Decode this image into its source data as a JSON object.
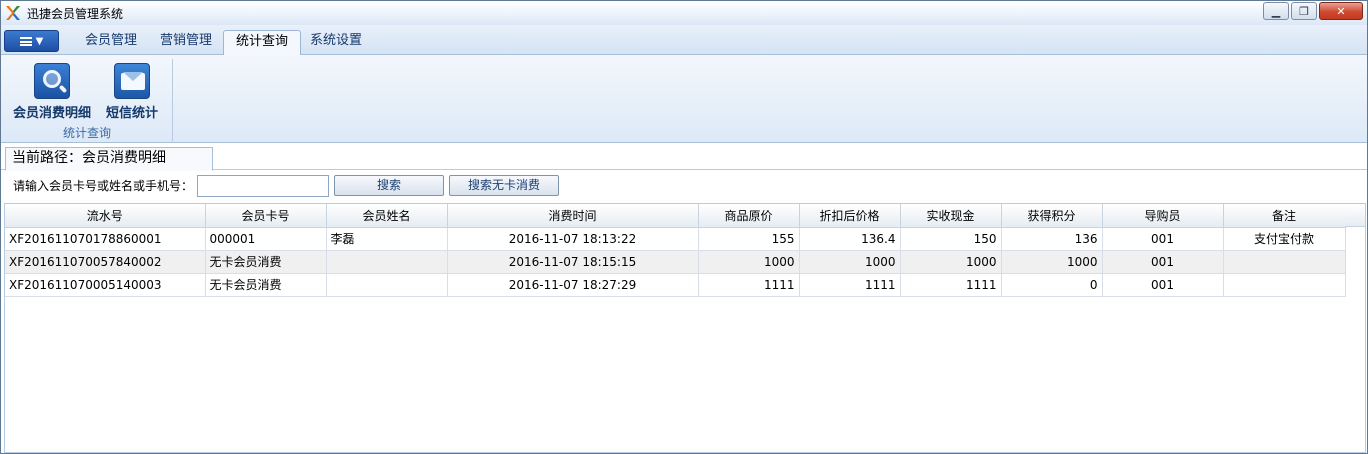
{
  "window": {
    "title": "迅捷会员管理系统",
    "controls": [
      "minimize",
      "maximize",
      "close"
    ]
  },
  "tabs": [
    {
      "label": "会员管理",
      "active": false
    },
    {
      "label": "营销管理",
      "active": false
    },
    {
      "label": "统计查询",
      "active": true
    },
    {
      "label": "系统设置",
      "active": false
    }
  ],
  "ribbon": {
    "group_title": "统计查询",
    "buttons": [
      {
        "label": "会员消费明细",
        "icon": "search-icon"
      },
      {
        "label": "短信统计",
        "icon": "mail-icon"
      }
    ]
  },
  "path": {
    "label": "当前路径：会员消费明细"
  },
  "search": {
    "label": "请输入会员卡号或姓名或手机号：",
    "value": "",
    "search_button": "搜索",
    "search_nocard_button": "搜索无卡消费"
  },
  "table": {
    "columns": [
      "流水号",
      "会员卡号",
      "会员姓名",
      "消费时间",
      "商品原价",
      "折扣后价格",
      "实收现金",
      "获得积分",
      "导购员",
      "备注"
    ],
    "rows": [
      [
        "XF201611070178860001",
        "000001",
        "李磊",
        "2016-11-07 18:13:22",
        "155",
        "136.4",
        "150",
        "136",
        "001",
        "支付宝付款"
      ],
      [
        "XF201611070057840002",
        "无卡会员消费",
        "",
        "2016-11-07 18:15:15",
        "1000",
        "1000",
        "1000",
        "1000",
        "001",
        ""
      ],
      [
        "XF201611070005140003",
        "无卡会员消费",
        "",
        "2016-11-07 18:27:29",
        "1111",
        "1111",
        "1111",
        "0",
        "001",
        ""
      ]
    ]
  }
}
